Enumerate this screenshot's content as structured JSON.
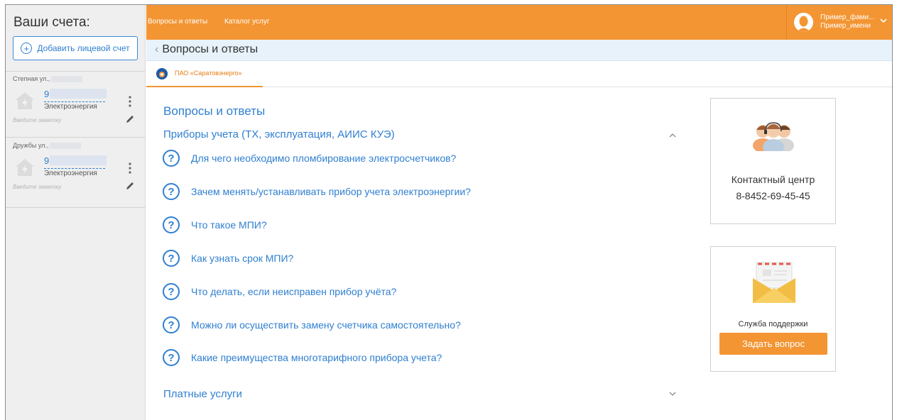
{
  "sidebar": {
    "title": "Ваши счета:",
    "add_button": "Добавить лицевой счет",
    "accounts": [
      {
        "address": "Степная ул.,",
        "number": "9",
        "type": "Электроэнергия",
        "note_placeholder": "Введите заметку"
      },
      {
        "address": "Дружбы ул.,",
        "number": "9",
        "type": "Электроэнергия",
        "note_placeholder": "Введите заметку"
      }
    ]
  },
  "topbar": {
    "links": [
      "Вопросы и ответы",
      "Каталог услуг"
    ],
    "user_surname": "Пример_фами...",
    "user_name": "Пример_имени"
  },
  "breadcrumb": {
    "title": "Вопросы и ответы"
  },
  "company_tab": {
    "name": "ПАО «Саратовэнерго»"
  },
  "main": {
    "title": "Вопросы и ответы",
    "sections": [
      {
        "title": "Приборы учета (ТХ, эксплуатация, АИИС КУЭ)",
        "expanded": true,
        "questions": [
          "Для чего необходимо пломбирование электросчетчиков?",
          "Зачем менять/устанавливать прибор учета электроэнергии?",
          "Что такое МПИ?",
          "Как узнать срок МПИ?",
          "Что делать, если неисправен прибор учёта?",
          "Можно ли осуществить замену счетчика самостоятельно?",
          "Какие преимущества многотарифного прибора учета?"
        ]
      },
      {
        "title": "Платные услуги",
        "expanded": false
      }
    ]
  },
  "contact_card": {
    "title": "Контактный центр",
    "phone": "8-8452-69-45-45"
  },
  "support_card": {
    "title": "Служба поддержки",
    "button": "Задать вопрос"
  },
  "colors": {
    "accent": "#f39533",
    "link": "#2f7fd0",
    "sidebar_bg": "#efefef",
    "breadcrumb_bg": "#e8f2fb"
  }
}
